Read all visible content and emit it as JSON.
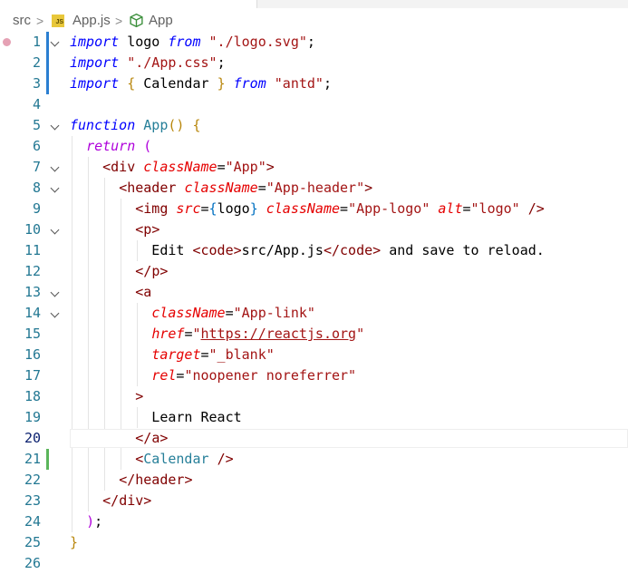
{
  "breadcrumb": {
    "folder": "src",
    "file": "App.js",
    "file_badge": "JS",
    "symbol": "App",
    "separator": ">"
  },
  "editor": {
    "active_line": 20,
    "breakpoint_line": 1,
    "lines": [
      {
        "n": "1",
        "tokens": [
          {
            "t": "import",
            "c": "kw-it"
          },
          {
            "t": " logo ",
            "c": "plain"
          },
          {
            "t": "from",
            "c": "kw-it"
          },
          {
            "t": " ",
            "c": "plain"
          },
          {
            "t": "\"./logo.svg\"",
            "c": "str"
          },
          {
            "t": ";",
            "c": "plain"
          }
        ]
      },
      {
        "n": "2",
        "tokens": [
          {
            "t": "import",
            "c": "kw-it"
          },
          {
            "t": " ",
            "c": "plain"
          },
          {
            "t": "\"./App.css\"",
            "c": "str"
          },
          {
            "t": ";",
            "c": "plain"
          }
        ]
      },
      {
        "n": "3",
        "tokens": [
          {
            "t": "import",
            "c": "kw-it"
          },
          {
            "t": " ",
            "c": "plain"
          },
          {
            "t": "{",
            "c": "brk1"
          },
          {
            "t": " Calendar ",
            "c": "plain"
          },
          {
            "t": "}",
            "c": "brk1"
          },
          {
            "t": " ",
            "c": "plain"
          },
          {
            "t": "from",
            "c": "kw-it"
          },
          {
            "t": " ",
            "c": "plain"
          },
          {
            "t": "\"antd\"",
            "c": "str"
          },
          {
            "t": ";",
            "c": "plain"
          }
        ]
      },
      {
        "n": "4",
        "tokens": []
      },
      {
        "n": "5",
        "tokens": [
          {
            "t": "function",
            "c": "kw-it"
          },
          {
            "t": " ",
            "c": "plain"
          },
          {
            "t": "App",
            "c": "fn"
          },
          {
            "t": "()",
            "c": "brk1"
          },
          {
            "t": " ",
            "c": "plain"
          },
          {
            "t": "{",
            "c": "brk1"
          }
        ]
      },
      {
        "n": "6",
        "tokens": [
          {
            "t": "  ",
            "c": "plain"
          },
          {
            "t": "return",
            "c": "kw-ctl"
          },
          {
            "t": " ",
            "c": "plain"
          },
          {
            "t": "(",
            "c": "brk2"
          }
        ]
      },
      {
        "n": "7",
        "tokens": [
          {
            "t": "    ",
            "c": "plain"
          },
          {
            "t": "<",
            "c": "tagp"
          },
          {
            "t": "div",
            "c": "tag"
          },
          {
            "t": " ",
            "c": "plain"
          },
          {
            "t": "className",
            "c": "attr"
          },
          {
            "t": "=",
            "c": "plain"
          },
          {
            "t": "\"App\"",
            "c": "str"
          },
          {
            "t": ">",
            "c": "tagp"
          }
        ]
      },
      {
        "n": "8",
        "tokens": [
          {
            "t": "      ",
            "c": "plain"
          },
          {
            "t": "<",
            "c": "tagp"
          },
          {
            "t": "header",
            "c": "tag"
          },
          {
            "t": " ",
            "c": "plain"
          },
          {
            "t": "className",
            "c": "attr"
          },
          {
            "t": "=",
            "c": "plain"
          },
          {
            "t": "\"App-header\"",
            "c": "str"
          },
          {
            "t": ">",
            "c": "tagp"
          }
        ]
      },
      {
        "n": "9",
        "tokens": [
          {
            "t": "        ",
            "c": "plain"
          },
          {
            "t": "<",
            "c": "tagp"
          },
          {
            "t": "img",
            "c": "tag"
          },
          {
            "t": " ",
            "c": "plain"
          },
          {
            "t": "src",
            "c": "attr"
          },
          {
            "t": "=",
            "c": "plain"
          },
          {
            "t": "{",
            "c": "brk3"
          },
          {
            "t": "logo",
            "c": "plain"
          },
          {
            "t": "}",
            "c": "brk3"
          },
          {
            "t": " ",
            "c": "plain"
          },
          {
            "t": "className",
            "c": "attr"
          },
          {
            "t": "=",
            "c": "plain"
          },
          {
            "t": "\"App-logo\"",
            "c": "str"
          },
          {
            "t": " ",
            "c": "plain"
          },
          {
            "t": "alt",
            "c": "attr"
          },
          {
            "t": "=",
            "c": "plain"
          },
          {
            "t": "\"logo\"",
            "c": "str"
          },
          {
            "t": " ",
            "c": "plain"
          },
          {
            "t": "/>",
            "c": "tagp"
          }
        ]
      },
      {
        "n": "10",
        "tokens": [
          {
            "t": "        ",
            "c": "plain"
          },
          {
            "t": "<",
            "c": "tagp"
          },
          {
            "t": "p",
            "c": "tag"
          },
          {
            "t": ">",
            "c": "tagp"
          }
        ]
      },
      {
        "n": "11",
        "tokens": [
          {
            "t": "          Edit ",
            "c": "plain"
          },
          {
            "t": "<",
            "c": "tagp"
          },
          {
            "t": "code",
            "c": "tag"
          },
          {
            "t": ">",
            "c": "tagp"
          },
          {
            "t": "src/App.js",
            "c": "plain"
          },
          {
            "t": "</",
            "c": "tagp"
          },
          {
            "t": "code",
            "c": "tag"
          },
          {
            "t": ">",
            "c": "tagp"
          },
          {
            "t": " and save to reload.",
            "c": "plain"
          }
        ]
      },
      {
        "n": "12",
        "tokens": [
          {
            "t": "        ",
            "c": "plain"
          },
          {
            "t": "</",
            "c": "tagp"
          },
          {
            "t": "p",
            "c": "tag"
          },
          {
            "t": ">",
            "c": "tagp"
          }
        ]
      },
      {
        "n": "13",
        "tokens": [
          {
            "t": "        ",
            "c": "plain"
          },
          {
            "t": "<",
            "c": "tagp"
          },
          {
            "t": "a",
            "c": "tag"
          }
        ]
      },
      {
        "n": "14",
        "tokens": [
          {
            "t": "          ",
            "c": "plain"
          },
          {
            "t": "className",
            "c": "attr"
          },
          {
            "t": "=",
            "c": "plain"
          },
          {
            "t": "\"App-link\"",
            "c": "str"
          }
        ]
      },
      {
        "n": "15",
        "tokens": [
          {
            "t": "          ",
            "c": "plain"
          },
          {
            "t": "href",
            "c": "attr"
          },
          {
            "t": "=",
            "c": "plain"
          },
          {
            "t": "\"",
            "c": "str"
          },
          {
            "t": "https://reactjs.org",
            "c": "str url"
          },
          {
            "t": "\"",
            "c": "str"
          }
        ]
      },
      {
        "n": "16",
        "tokens": [
          {
            "t": "          ",
            "c": "plain"
          },
          {
            "t": "target",
            "c": "attr"
          },
          {
            "t": "=",
            "c": "plain"
          },
          {
            "t": "\"_blank\"",
            "c": "str"
          }
        ]
      },
      {
        "n": "17",
        "tokens": [
          {
            "t": "          ",
            "c": "plain"
          },
          {
            "t": "rel",
            "c": "attr"
          },
          {
            "t": "=",
            "c": "plain"
          },
          {
            "t": "\"noopener noreferrer\"",
            "c": "str"
          }
        ]
      },
      {
        "n": "18",
        "tokens": [
          {
            "t": "        ",
            "c": "plain"
          },
          {
            "t": ">",
            "c": "tagp"
          }
        ]
      },
      {
        "n": "19",
        "tokens": [
          {
            "t": "          Learn React",
            "c": "plain"
          }
        ]
      },
      {
        "n": "20",
        "tokens": [
          {
            "t": "        ",
            "c": "plain"
          },
          {
            "t": "</",
            "c": "tagp"
          },
          {
            "t": "a",
            "c": "tag"
          },
          {
            "t": ">",
            "c": "tagp"
          }
        ]
      },
      {
        "n": "21",
        "tokens": [
          {
            "t": "        ",
            "c": "plain"
          },
          {
            "t": "<",
            "c": "tagp"
          },
          {
            "t": "Calendar",
            "c": "comp"
          },
          {
            "t": " ",
            "c": "plain"
          },
          {
            "t": "/>",
            "c": "tagp"
          }
        ]
      },
      {
        "n": "22",
        "tokens": [
          {
            "t": "      ",
            "c": "plain"
          },
          {
            "t": "</",
            "c": "tagp"
          },
          {
            "t": "header",
            "c": "tag"
          },
          {
            "t": ">",
            "c": "tagp"
          }
        ]
      },
      {
        "n": "23",
        "tokens": [
          {
            "t": "    ",
            "c": "plain"
          },
          {
            "t": "</",
            "c": "tagp"
          },
          {
            "t": "div",
            "c": "tag"
          },
          {
            "t": ">",
            "c": "tagp"
          }
        ]
      },
      {
        "n": "24",
        "tokens": [
          {
            "t": "  ",
            "c": "plain"
          },
          {
            "t": ")",
            "c": "brk2"
          },
          {
            "t": ";",
            "c": "plain"
          }
        ]
      },
      {
        "n": "25",
        "tokens": [
          {
            "t": "}",
            "c": "brk1"
          }
        ]
      },
      {
        "n": "26",
        "tokens": []
      }
    ]
  },
  "colors": {
    "gutter_modified": "#2b7fd1",
    "gutter_added": "#5bb55b",
    "guide": "#e4e4e4",
    "active_guide": "#e0d0f0"
  }
}
